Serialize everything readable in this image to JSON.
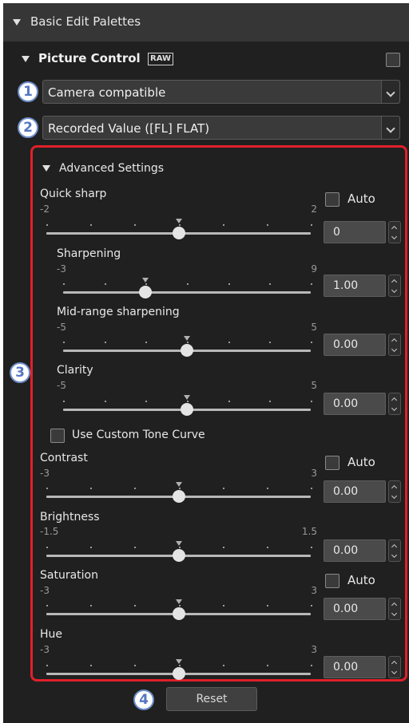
{
  "palette": {
    "title": "Basic Edit Palettes"
  },
  "picture_control": {
    "title": "Picture Control",
    "raw_badge": "RAW",
    "compat_select": "Camera compatible",
    "value_select": "Recorded Value ([FL] FLAT)"
  },
  "callouts": [
    "1",
    "2",
    "3",
    "4"
  ],
  "advanced": {
    "title": "Advanced Settings",
    "custom_tone_curve": "Use Custom Tone Curve",
    "sliders": [
      {
        "label": "Quick sharp",
        "min": "-2",
        "max": "2",
        "value": "0",
        "level": 0.5,
        "auto": true,
        "auto_label": "Auto"
      },
      {
        "label": "Sharpening",
        "min": "-3",
        "max": "9",
        "value": "1.00",
        "level": 0.333
      },
      {
        "label": "Mid-range sharpening",
        "min": "-5",
        "max": "5",
        "value": "0.00",
        "level": 0.5
      },
      {
        "label": "Clarity",
        "min": "-5",
        "max": "5",
        "value": "0.00",
        "level": 0.5
      },
      {
        "label": "Contrast",
        "min": "-3",
        "max": "3",
        "value": "0.00",
        "level": 0.5,
        "auto": true,
        "auto_label": "Auto"
      },
      {
        "label": "Brightness",
        "min": "-1.5",
        "max": "1.5",
        "value": "0.00",
        "level": 0.5
      },
      {
        "label": "Saturation",
        "min": "-3",
        "max": "3",
        "value": "0.00",
        "level": 0.5,
        "auto": true,
        "auto_label": "Auto"
      },
      {
        "label": "Hue",
        "min": "-3",
        "max": "3",
        "value": "0.00",
        "level": 0.5
      }
    ]
  },
  "reset_label": "Reset",
  "colors": {
    "highlight_frame": "#e0202a",
    "callout": "#5577c2",
    "panel": "#202020"
  }
}
